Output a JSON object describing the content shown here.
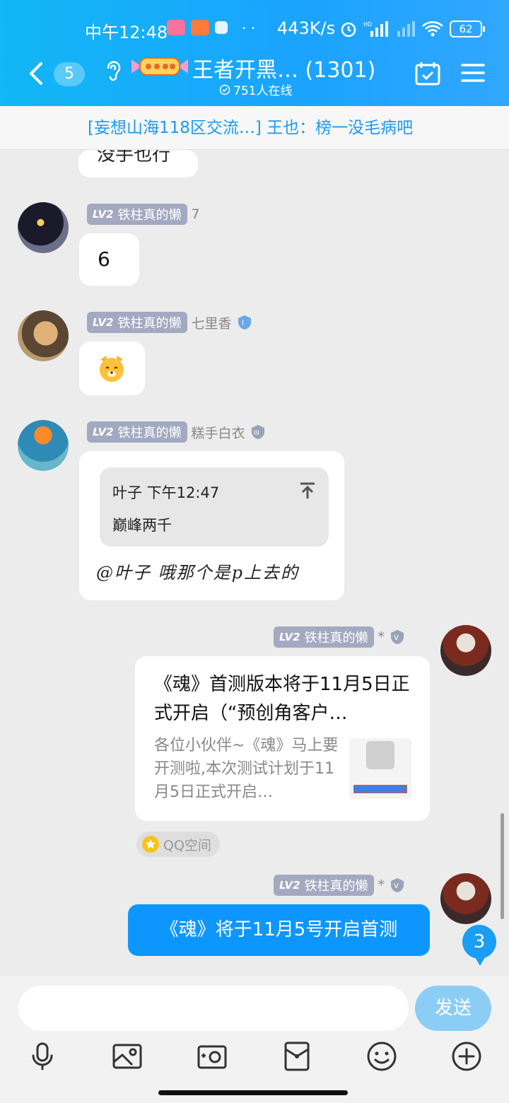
{
  "status_bar": {
    "time": "中午12:48",
    "dots": "· ·",
    "net_speed": "443K/s",
    "battery": "62"
  },
  "header": {
    "back_count": "5",
    "group_title": "王者开黑… (1301)",
    "online_count": "751人在线"
  },
  "announcement": "[妄想山海118区交流…] 王也：榜一没毛病吧",
  "messages": [
    {
      "text": "没手也行"
    },
    {
      "level": "LV2",
      "nickname": "铁柱真的懒",
      "suffix": "7",
      "text": "6"
    },
    {
      "level": "LV2",
      "nickname": "铁柱真的懒",
      "suffix": "七里香"
    },
    {
      "level": "LV2",
      "nickname": "铁柱真的懒",
      "suffix": "糕手白衣",
      "quote": {
        "author_time": "叶子 下午12:47",
        "text": "巅峰两千"
      },
      "text": "@叶子 哦那个是p上去的"
    },
    {
      "level": "LV2",
      "nickname": "铁柱真的懒",
      "suffix": "*",
      "card": {
        "title": "《魂》首测版本将于11月5日正式开启（“预创角客户…",
        "desc": "各位小伙伴~《魂》马上要开测啦,本次测试计划于11月5日正式开启…"
      },
      "source": "QQ空间"
    },
    {
      "level": "LV2",
      "nickname": "铁柱真的懒",
      "suffix": "*",
      "text": "《魂》将于11月5号开启首测"
    }
  ],
  "unread_badge": "3",
  "input": {
    "placeholder": "",
    "send_label": "发送"
  },
  "colors": {
    "header_blue": "#12b7f5",
    "bubble_blue": "#0e96ff",
    "send_disabled": "#8ccdf6"
  }
}
